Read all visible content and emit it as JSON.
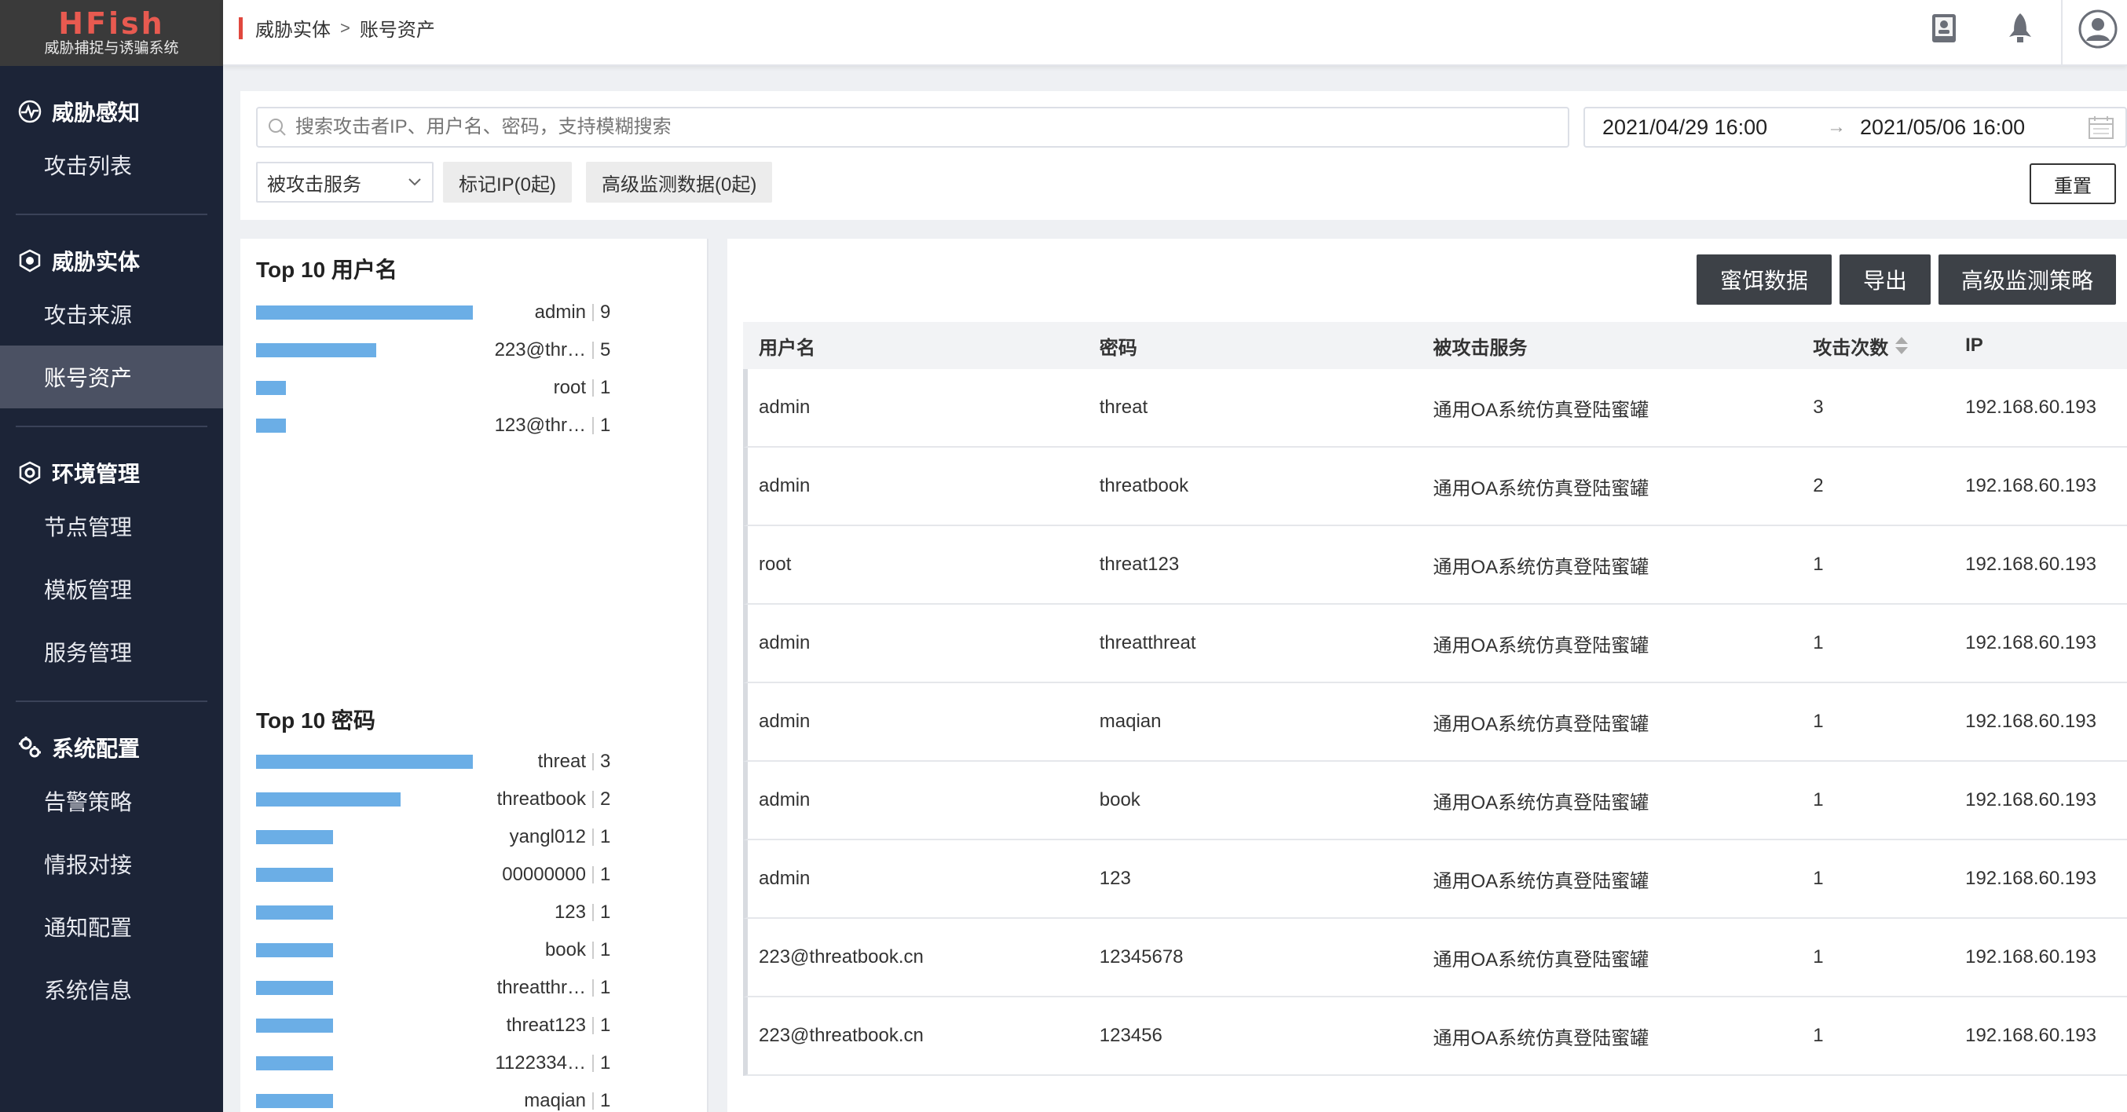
{
  "app": {
    "logo_title": "HFish",
    "logo_subtitle": "威胁捕捉与诱骗系统"
  },
  "sidebar": {
    "sections": [
      {
        "heading": "威胁感知",
        "icon": "radar-icon",
        "items": [
          {
            "label": "攻击列表",
            "active": false
          }
        ]
      },
      {
        "heading": "威胁实体",
        "icon": "shield-icon",
        "items": [
          {
            "label": "攻击来源",
            "active": false
          },
          {
            "label": "账号资产",
            "active": true
          }
        ]
      },
      {
        "heading": "环境管理",
        "icon": "hex-gear-icon",
        "items": [
          {
            "label": "节点管理",
            "active": false
          },
          {
            "label": "模板管理",
            "active": false
          },
          {
            "label": "服务管理",
            "active": false
          }
        ]
      },
      {
        "heading": "系统配置",
        "icon": "gears-icon",
        "items": [
          {
            "label": "告警策略",
            "active": false
          },
          {
            "label": "情报对接",
            "active": false
          },
          {
            "label": "通知配置",
            "active": false
          },
          {
            "label": "系统信息",
            "active": false
          }
        ]
      }
    ]
  },
  "header": {
    "breadcrumb": [
      "威胁实体",
      "账号资产"
    ],
    "breadcrumb_sep": ">",
    "icons": [
      "book-icon",
      "rocket-icon",
      "avatar-icon"
    ]
  },
  "filter": {
    "search_placeholder": "搜索攻击者IP、用户名、密码，支持模糊搜索",
    "date_start": "2021/04/29 16:00",
    "date_end": "2021/05/06 16:00",
    "date_arrow": "→",
    "service_select": "被攻击服务",
    "tag_ip": "标记IP(0起)",
    "advanced_monitor": "高级监测数据(0起)",
    "reset": "重置"
  },
  "stats": {
    "usernames": {
      "title": "Top 10 用户名",
      "rows": [
        {
          "label": "admin",
          "count": 9
        },
        {
          "label": "223@thr…",
          "count": 5
        },
        {
          "label": "root",
          "count": 1
        },
        {
          "label": "123@thr…",
          "count": 1
        }
      ]
    },
    "passwords": {
      "title": "Top 10 密码",
      "rows": [
        {
          "label": "threat",
          "count": 3
        },
        {
          "label": "threatbook",
          "count": 2
        },
        {
          "label": "yangl012",
          "count": 1
        },
        {
          "label": "00000000",
          "count": 1
        },
        {
          "label": "123",
          "count": 1
        },
        {
          "label": "book",
          "count": 1
        },
        {
          "label": "threatthr…",
          "count": 1
        },
        {
          "label": "threat123",
          "count": 1
        },
        {
          "label": "1122334…",
          "count": 1
        },
        {
          "label": "maqian",
          "count": 1
        }
      ]
    }
  },
  "toolbar": {
    "honey_data": "蜜饵数据",
    "export": "导出",
    "advanced_policy": "高级监测策略"
  },
  "table": {
    "columns": [
      "用户名",
      "密码",
      "被攻击服务",
      "攻击次数",
      "IP"
    ],
    "rows": [
      [
        "admin",
        "threat",
        "通用OA系统仿真登陆蜜罐",
        "3",
        "192.168.60.193"
      ],
      [
        "admin",
        "threatbook",
        "通用OA系统仿真登陆蜜罐",
        "2",
        "192.168.60.193"
      ],
      [
        "root",
        "threat123",
        "通用OA系统仿真登陆蜜罐",
        "1",
        "192.168.60.193"
      ],
      [
        "admin",
        "threatthreat",
        "通用OA系统仿真登陆蜜罐",
        "1",
        "192.168.60.193"
      ],
      [
        "admin",
        "maqian",
        "通用OA系统仿真登陆蜜罐",
        "1",
        "192.168.60.193"
      ],
      [
        "admin",
        "book",
        "通用OA系统仿真登陆蜜罐",
        "1",
        "192.168.60.193"
      ],
      [
        "admin",
        "123",
        "通用OA系统仿真登陆蜜罐",
        "1",
        "192.168.60.193"
      ],
      [
        "223@threatbook.cn",
        "12345678",
        "通用OA系统仿真登陆蜜罐",
        "1",
        "192.168.60.193"
      ],
      [
        "223@threatbook.cn",
        "123456",
        "通用OA系统仿真登陆蜜罐",
        "1",
        "192.168.60.193"
      ]
    ]
  },
  "colors": {
    "sidebar_bg": "#1c2437",
    "accent_red": "#e0483e",
    "bar_blue": "#6baee6",
    "button_dark": "#3d4147"
  }
}
